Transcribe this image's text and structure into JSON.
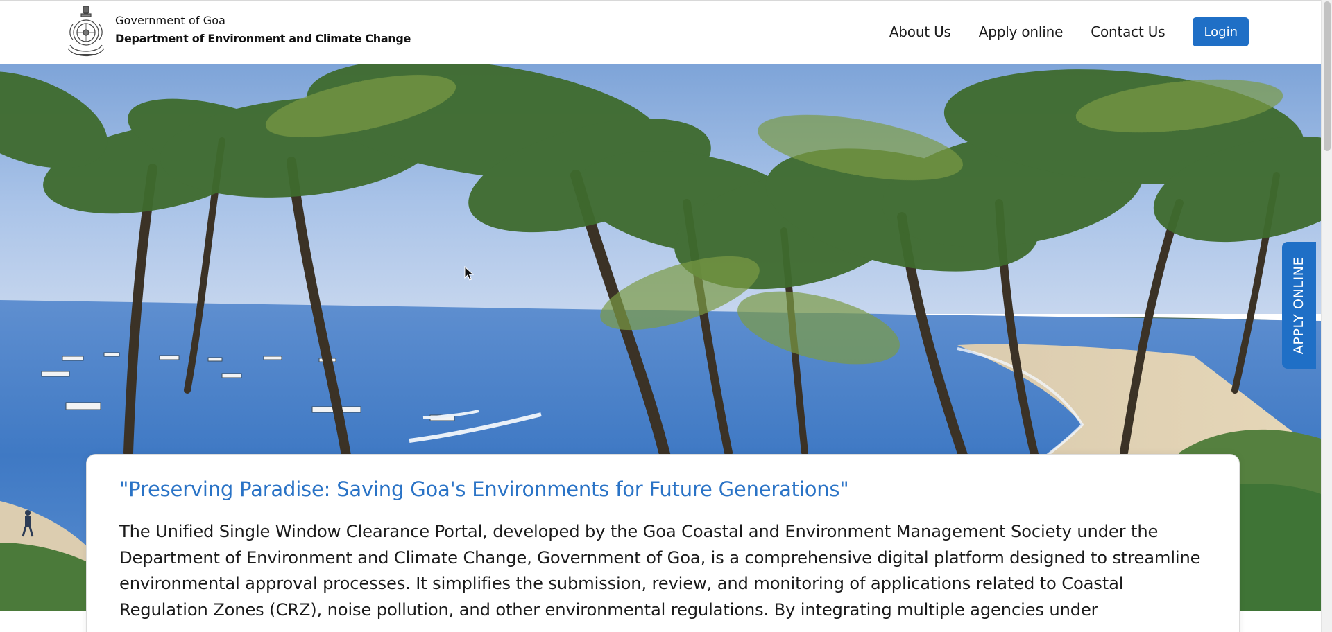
{
  "header": {
    "org_line1": "Government of Goa",
    "org_line2": "Department of Environment and Climate Change",
    "nav": [
      {
        "label": "About Us"
      },
      {
        "label": "Apply online"
      },
      {
        "label": "Contact Us"
      }
    ],
    "login_label": "Login"
  },
  "side_tab": {
    "label": "APPLY ONLINE"
  },
  "card": {
    "title": "\"Preserving Paradise: Saving Goa's Environments for Future Generations\"",
    "body": "The Unified Single Window Clearance Portal, developed by the Goa Coastal and Environment Management Society under the Department of Environment and Climate Change, Government of Goa, is a comprehensive digital platform designed to streamline environmental approval processes. It simplifies the submission, review, and monitoring of applications related to Coastal Regulation Zones (CRZ), noise pollution, and other environmental regulations. By integrating multiple agencies under"
  },
  "colors": {
    "primary": "#1f6fc6",
    "title_blue": "#2a73c6",
    "text": "#1b1b1b"
  },
  "icons": {
    "logo": "state-emblem-icon",
    "cursor": "mouse-pointer-icon"
  }
}
